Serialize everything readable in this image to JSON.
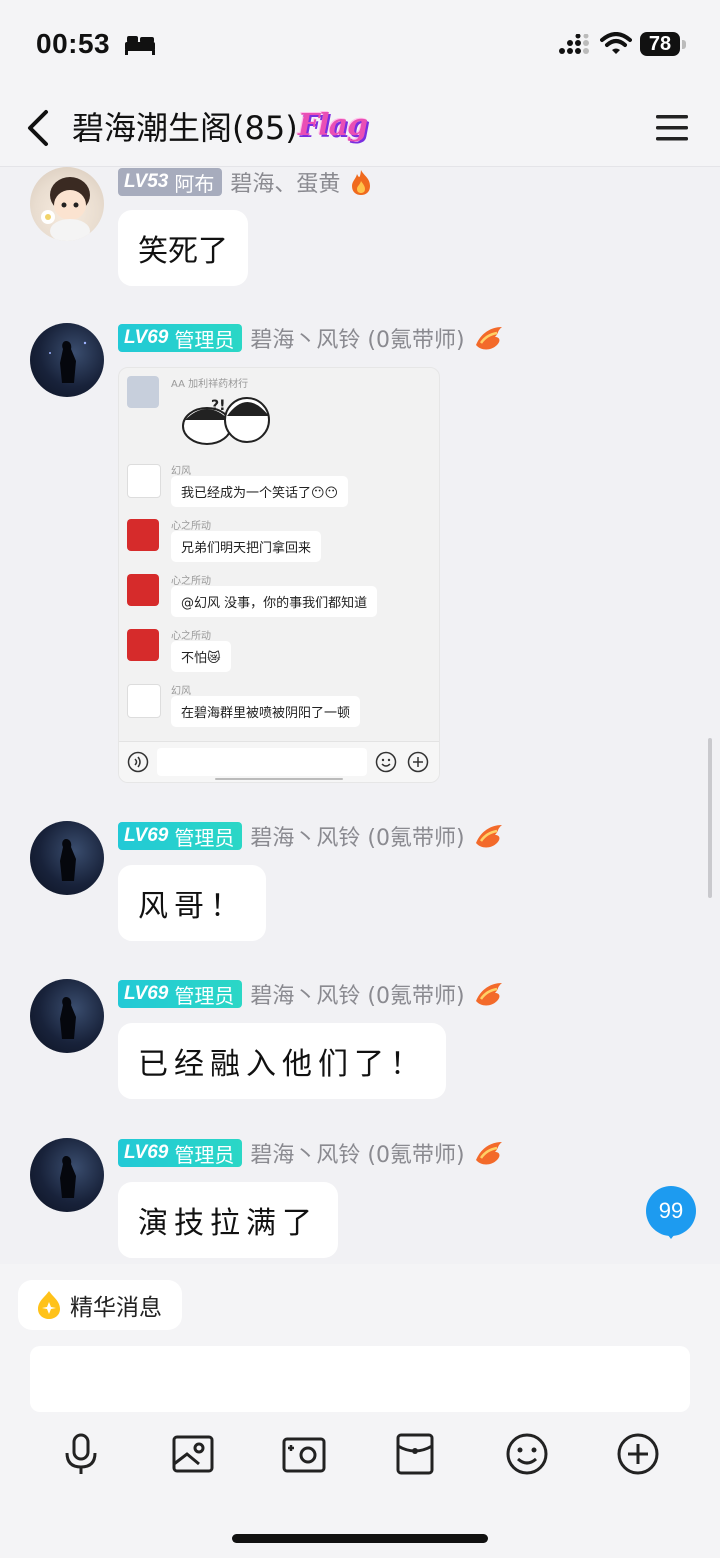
{
  "status_bar": {
    "time": "00:53",
    "battery": "78",
    "icons": [
      "bed-icon",
      "signal-icon",
      "wifi-icon",
      "battery-icon"
    ]
  },
  "header": {
    "title": "碧海潮生阁(85)",
    "flag_text": "Flag",
    "icons": [
      "back-icon",
      "menu-icon"
    ]
  },
  "messages": [
    {
      "level": "LV53",
      "role": "阿布",
      "nickname": "碧海、蛋黄",
      "title_icon": "flame-icon",
      "text": "笑死了"
    },
    {
      "level": "LV69",
      "role": "管理员",
      "nickname": "碧海丶风铃 (0氪带师)",
      "title_icon": "dragon-icon",
      "image": {
        "top_name": "AA 加利祥药材行",
        "sticker_text": "?!",
        "rows": [
          {
            "name": "幻风",
            "text": "我已经成为一个笑话了😶😶"
          },
          {
            "name": "心之所动",
            "text": "兄弟们明天把门拿回来"
          },
          {
            "name": "心之所动",
            "text": "@幻风  没事，你的事我们都知道"
          },
          {
            "name": "心之所动",
            "text": "不怕😿"
          },
          {
            "name": "幻风",
            "text": "在碧海群里被喷被阴阳了一顿"
          }
        ]
      }
    },
    {
      "level": "LV69",
      "role": "管理员",
      "nickname": "碧海丶风铃 (0氪带师)",
      "title_icon": "dragon-icon",
      "text": "风哥！"
    },
    {
      "level": "LV69",
      "role": "管理员",
      "nickname": "碧海丶风铃 (0氪带师)",
      "title_icon": "dragon-icon",
      "text": "已经融入他们了！"
    },
    {
      "level": "LV69",
      "role": "管理员",
      "nickname": "碧海丶风铃 (0氪带师)",
      "title_icon": "dragon-icon",
      "text": "演技拉满了"
    }
  ],
  "unread_count": "99",
  "bottom": {
    "essence_label": "精华消息",
    "input_value": "",
    "tools": [
      "microphone-icon",
      "image-icon",
      "camera-icon",
      "red-packet-icon",
      "emoji-icon",
      "plus-icon"
    ]
  },
  "colors": {
    "badge_gray": "#a7acbd",
    "badge_cyan": "#22c9d6",
    "unread": "#1d9bf0",
    "background": "#f1f1f4"
  }
}
